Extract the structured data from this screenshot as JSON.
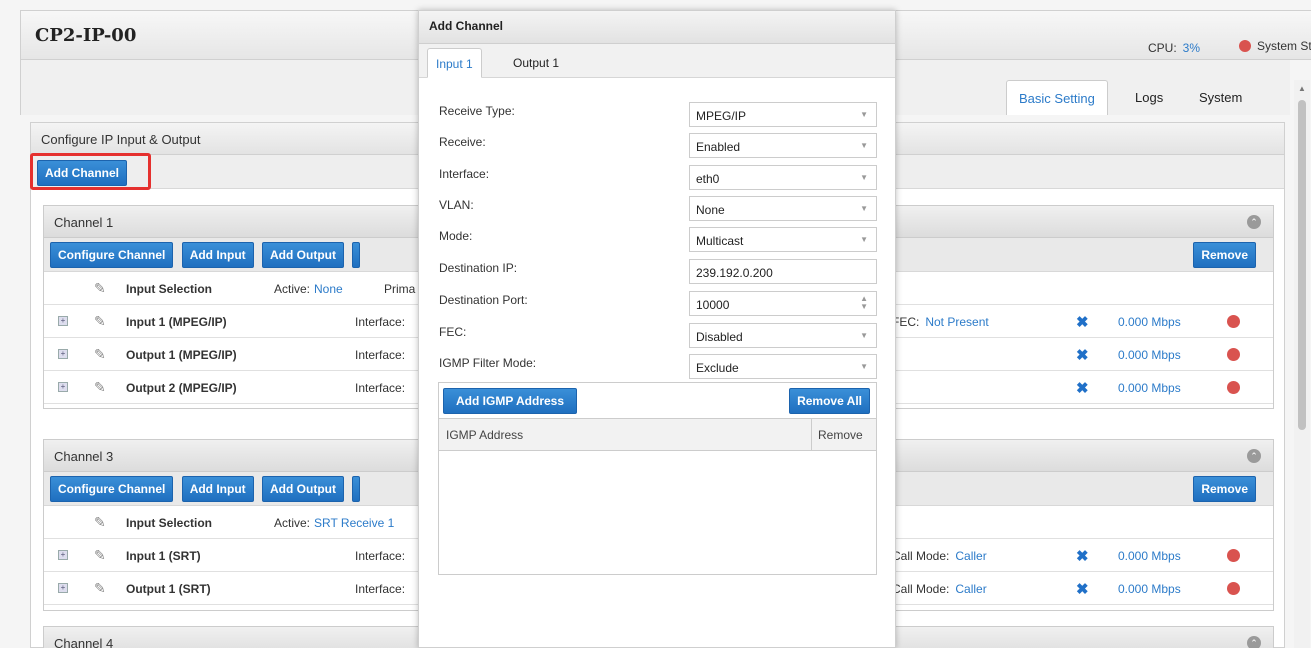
{
  "header": {
    "title": "CP2-IP-00",
    "cpu_label": "CPU:",
    "cpu_value": "3%",
    "status_label": "System Sta"
  },
  "tabs": [
    {
      "label": "Basic Setting",
      "active": true
    },
    {
      "label": "Logs",
      "active": false
    },
    {
      "label": "System",
      "active": false
    }
  ],
  "panel": {
    "title": "Configure IP Input & Output",
    "add_channel_label": "Add Channel"
  },
  "channel_buttons": {
    "configure": "Configure Channel",
    "add_input": "Add Input",
    "add_output": "Add Output",
    "remove": "Remove"
  },
  "channel1": {
    "title": "Channel 1",
    "input_selection": {
      "label": "Input Selection",
      "active_label": "Active:",
      "active_value": "None",
      "prim": "Prima"
    },
    "rows": [
      {
        "name": "Input 1 (MPEG/IP)",
        "iface": "Interface:",
        "extra_label": "FEC:",
        "extra_value": "Not Present",
        "rate": "0.000  Mbps"
      },
      {
        "name": "Output 1 (MPEG/IP)",
        "iface": "Interface:",
        "extra_label": "",
        "extra_value": "",
        "rate": "0.000  Mbps"
      },
      {
        "name": "Output 2 (MPEG/IP)",
        "iface": "Interface:",
        "extra_label": "",
        "extra_value": "",
        "rate": "0.000  Mbps"
      }
    ]
  },
  "channel3": {
    "title": "Channel 3",
    "input_selection": {
      "label": "Input Selection",
      "active_label": "Active:",
      "active_value": "SRT Receive 1"
    },
    "rows": [
      {
        "name": "Input 1 (SRT)",
        "iface": "Interface:",
        "extra_label": "Call Mode:",
        "extra_value": "Caller",
        "rate": "0.000  Mbps"
      },
      {
        "name": "Output 1 (SRT)",
        "iface": "Interface:",
        "extra_label": "Call Mode:",
        "extra_value": "Caller",
        "rate": "0.000  Mbps"
      }
    ]
  },
  "channel4": {
    "title": "Channel 4"
  },
  "dialog": {
    "title": "Add Channel",
    "tabs": [
      {
        "label": "Input 1",
        "active": true
      },
      {
        "label": "Output 1",
        "active": false
      }
    ],
    "fields": [
      {
        "label": "Receive Type:",
        "value": "MPEG/IP",
        "kind": "select"
      },
      {
        "label": "Receive:",
        "value": "Enabled",
        "kind": "select"
      },
      {
        "label": "Interface:",
        "value": "eth0",
        "kind": "select"
      },
      {
        "label": "VLAN:",
        "value": "None",
        "kind": "select"
      },
      {
        "label": "Mode:",
        "value": "Multicast",
        "kind": "select"
      },
      {
        "label": "Destination IP:",
        "value": "239.192.0.200",
        "kind": "text"
      },
      {
        "label": "Destination Port:",
        "value": "10000",
        "kind": "spinner"
      },
      {
        "label": "FEC:",
        "value": "Disabled",
        "kind": "select"
      },
      {
        "label": "IGMP Filter Mode:",
        "value": "Exclude",
        "kind": "select"
      }
    ],
    "igmp": {
      "add_label": "Add IGMP Address",
      "remove_all_label": "Remove All",
      "col_address": "IGMP Address",
      "col_remove": "Remove"
    }
  },
  "colors": {
    "accent": "#2c7bc9",
    "button": "#1f6fc0",
    "status_red": "#d9534f",
    "highlight": "#e5302e"
  }
}
